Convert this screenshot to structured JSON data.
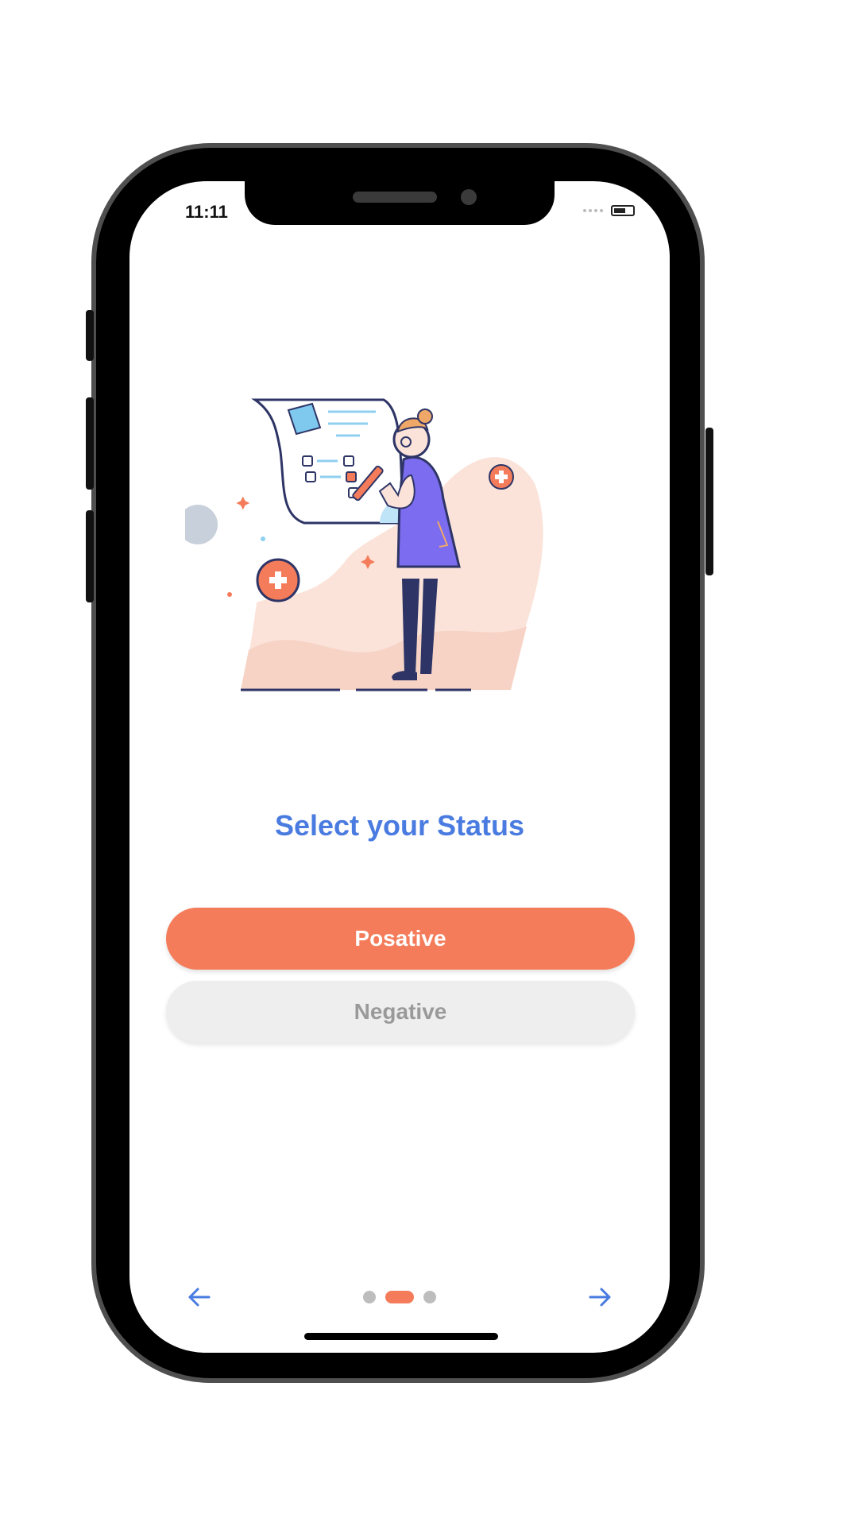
{
  "status_bar": {
    "time": "11:11"
  },
  "screen": {
    "title": "Select your Status",
    "buttons": {
      "positive_label": "Posative",
      "negative_label": "Negative"
    },
    "pagination": {
      "current_page": 2,
      "total_pages": 3
    }
  },
  "icons": {
    "back": "arrow-left-icon",
    "next": "arrow-right-icon",
    "battery": "battery-icon",
    "signal": "signal-icon"
  },
  "colors": {
    "accent": "#f47c5a",
    "title": "#4a7be0",
    "negative_bg": "#eeeeee",
    "negative_text": "#9a9a9a",
    "figure_dress": "#7b6cf0",
    "figure_dark": "#2e3566"
  }
}
